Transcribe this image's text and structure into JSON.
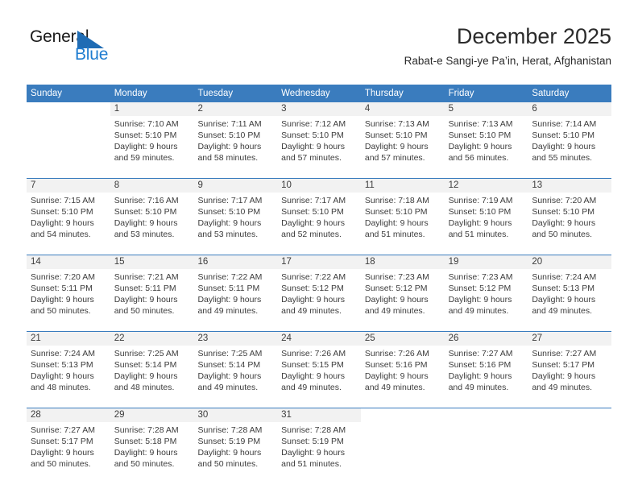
{
  "logo": {
    "word_top": "General",
    "word_bottom": "Blue",
    "triangle_color": "#1f6cb4",
    "blue_color": "#1f7dd0"
  },
  "header": {
    "title": "December 2025",
    "subtitle": "Rabat-e Sangi-ye Pa’in, Herat, Afghanistan"
  },
  "theme": {
    "header_band": "#3a7cbe",
    "daynum_band": "#f2f2f2",
    "text": "#3c3c3c"
  },
  "weekdays": [
    "Sunday",
    "Monday",
    "Tuesday",
    "Wednesday",
    "Thursday",
    "Friday",
    "Saturday"
  ],
  "weeks": [
    [
      {
        "day": "",
        "l1": "",
        "l2": "",
        "l3": "",
        "l4": ""
      },
      {
        "day": "1",
        "l1": "Sunrise: 7:10 AM",
        "l2": "Sunset: 5:10 PM",
        "l3": "Daylight: 9 hours",
        "l4": "and 59 minutes."
      },
      {
        "day": "2",
        "l1": "Sunrise: 7:11 AM",
        "l2": "Sunset: 5:10 PM",
        "l3": "Daylight: 9 hours",
        "l4": "and 58 minutes."
      },
      {
        "day": "3",
        "l1": "Sunrise: 7:12 AM",
        "l2": "Sunset: 5:10 PM",
        "l3": "Daylight: 9 hours",
        "l4": "and 57 minutes."
      },
      {
        "day": "4",
        "l1": "Sunrise: 7:13 AM",
        "l2": "Sunset: 5:10 PM",
        "l3": "Daylight: 9 hours",
        "l4": "and 57 minutes."
      },
      {
        "day": "5",
        "l1": "Sunrise: 7:13 AM",
        "l2": "Sunset: 5:10 PM",
        "l3": "Daylight: 9 hours",
        "l4": "and 56 minutes."
      },
      {
        "day": "6",
        "l1": "Sunrise: 7:14 AM",
        "l2": "Sunset: 5:10 PM",
        "l3": "Daylight: 9 hours",
        "l4": "and 55 minutes."
      }
    ],
    [
      {
        "day": "7",
        "l1": "Sunrise: 7:15 AM",
        "l2": "Sunset: 5:10 PM",
        "l3": "Daylight: 9 hours",
        "l4": "and 54 minutes."
      },
      {
        "day": "8",
        "l1": "Sunrise: 7:16 AM",
        "l2": "Sunset: 5:10 PM",
        "l3": "Daylight: 9 hours",
        "l4": "and 53 minutes."
      },
      {
        "day": "9",
        "l1": "Sunrise: 7:17 AM",
        "l2": "Sunset: 5:10 PM",
        "l3": "Daylight: 9 hours",
        "l4": "and 53 minutes."
      },
      {
        "day": "10",
        "l1": "Sunrise: 7:17 AM",
        "l2": "Sunset: 5:10 PM",
        "l3": "Daylight: 9 hours",
        "l4": "and 52 minutes."
      },
      {
        "day": "11",
        "l1": "Sunrise: 7:18 AM",
        "l2": "Sunset: 5:10 PM",
        "l3": "Daylight: 9 hours",
        "l4": "and 51 minutes."
      },
      {
        "day": "12",
        "l1": "Sunrise: 7:19 AM",
        "l2": "Sunset: 5:10 PM",
        "l3": "Daylight: 9 hours",
        "l4": "and 51 minutes."
      },
      {
        "day": "13",
        "l1": "Sunrise: 7:20 AM",
        "l2": "Sunset: 5:10 PM",
        "l3": "Daylight: 9 hours",
        "l4": "and 50 minutes."
      }
    ],
    [
      {
        "day": "14",
        "l1": "Sunrise: 7:20 AM",
        "l2": "Sunset: 5:11 PM",
        "l3": "Daylight: 9 hours",
        "l4": "and 50 minutes."
      },
      {
        "day": "15",
        "l1": "Sunrise: 7:21 AM",
        "l2": "Sunset: 5:11 PM",
        "l3": "Daylight: 9 hours",
        "l4": "and 50 minutes."
      },
      {
        "day": "16",
        "l1": "Sunrise: 7:22 AM",
        "l2": "Sunset: 5:11 PM",
        "l3": "Daylight: 9 hours",
        "l4": "and 49 minutes."
      },
      {
        "day": "17",
        "l1": "Sunrise: 7:22 AM",
        "l2": "Sunset: 5:12 PM",
        "l3": "Daylight: 9 hours",
        "l4": "and 49 minutes."
      },
      {
        "day": "18",
        "l1": "Sunrise: 7:23 AM",
        "l2": "Sunset: 5:12 PM",
        "l3": "Daylight: 9 hours",
        "l4": "and 49 minutes."
      },
      {
        "day": "19",
        "l1": "Sunrise: 7:23 AM",
        "l2": "Sunset: 5:12 PM",
        "l3": "Daylight: 9 hours",
        "l4": "and 49 minutes."
      },
      {
        "day": "20",
        "l1": "Sunrise: 7:24 AM",
        "l2": "Sunset: 5:13 PM",
        "l3": "Daylight: 9 hours",
        "l4": "and 49 minutes."
      }
    ],
    [
      {
        "day": "21",
        "l1": "Sunrise: 7:24 AM",
        "l2": "Sunset: 5:13 PM",
        "l3": "Daylight: 9 hours",
        "l4": "and 48 minutes."
      },
      {
        "day": "22",
        "l1": "Sunrise: 7:25 AM",
        "l2": "Sunset: 5:14 PM",
        "l3": "Daylight: 9 hours",
        "l4": "and 48 minutes."
      },
      {
        "day": "23",
        "l1": "Sunrise: 7:25 AM",
        "l2": "Sunset: 5:14 PM",
        "l3": "Daylight: 9 hours",
        "l4": "and 49 minutes."
      },
      {
        "day": "24",
        "l1": "Sunrise: 7:26 AM",
        "l2": "Sunset: 5:15 PM",
        "l3": "Daylight: 9 hours",
        "l4": "and 49 minutes."
      },
      {
        "day": "25",
        "l1": "Sunrise: 7:26 AM",
        "l2": "Sunset: 5:16 PM",
        "l3": "Daylight: 9 hours",
        "l4": "and 49 minutes."
      },
      {
        "day": "26",
        "l1": "Sunrise: 7:27 AM",
        "l2": "Sunset: 5:16 PM",
        "l3": "Daylight: 9 hours",
        "l4": "and 49 minutes."
      },
      {
        "day": "27",
        "l1": "Sunrise: 7:27 AM",
        "l2": "Sunset: 5:17 PM",
        "l3": "Daylight: 9 hours",
        "l4": "and 49 minutes."
      }
    ],
    [
      {
        "day": "28",
        "l1": "Sunrise: 7:27 AM",
        "l2": "Sunset: 5:17 PM",
        "l3": "Daylight: 9 hours",
        "l4": "and 50 minutes."
      },
      {
        "day": "29",
        "l1": "Sunrise: 7:28 AM",
        "l2": "Sunset: 5:18 PM",
        "l3": "Daylight: 9 hours",
        "l4": "and 50 minutes."
      },
      {
        "day": "30",
        "l1": "Sunrise: 7:28 AM",
        "l2": "Sunset: 5:19 PM",
        "l3": "Daylight: 9 hours",
        "l4": "and 50 minutes."
      },
      {
        "day": "31",
        "l1": "Sunrise: 7:28 AM",
        "l2": "Sunset: 5:19 PM",
        "l3": "Daylight: 9 hours",
        "l4": "and 51 minutes."
      },
      {
        "day": "",
        "l1": "",
        "l2": "",
        "l3": "",
        "l4": ""
      },
      {
        "day": "",
        "l1": "",
        "l2": "",
        "l3": "",
        "l4": ""
      },
      {
        "day": "",
        "l1": "",
        "l2": "",
        "l3": "",
        "l4": ""
      }
    ]
  ]
}
